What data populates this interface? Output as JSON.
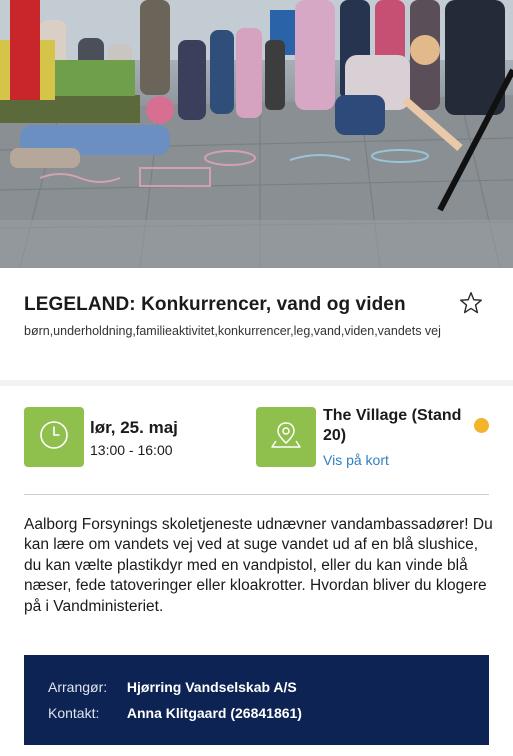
{
  "event": {
    "title": "LEGELAND: Konkurrencer, vand og viden",
    "tags": "børn,underholdning,familieaktivitet,konkurrencer,leg,vand,viden,vandets vej"
  },
  "when": {
    "date": "lør, 25. maj",
    "time": "13:00 - 16:00"
  },
  "where": {
    "name": "The Village (Stand 20)",
    "map_link": "Vis på kort"
  },
  "description": "Aalborg Forsynings skoletjeneste udnævner vandambassadører! Du kan lære om vandets vej ved at suge vandet ud af en blå slushice, du kan vælte plastikdyr med en vandpistol, eller du kan vinde blå næser, fede tatoveringer eller kloakrotter. Hvordan bliver du klogere på i Vandministeriet.",
  "organizer": {
    "label": "Arrangør:",
    "value": "Hjørring Vandselskab A/S"
  },
  "contact": {
    "label": "Kontakt:",
    "value": "Anna Klitgaard (26841861)"
  },
  "colors": {
    "icon_bg": "#8fbf4d",
    "status_dot": "#f2b42a",
    "link": "#2f7fc1",
    "info_bg": "#0d2354"
  },
  "icons": {
    "star": "star-outline-icon",
    "clock": "clock-icon",
    "location": "map-pin-icon"
  }
}
